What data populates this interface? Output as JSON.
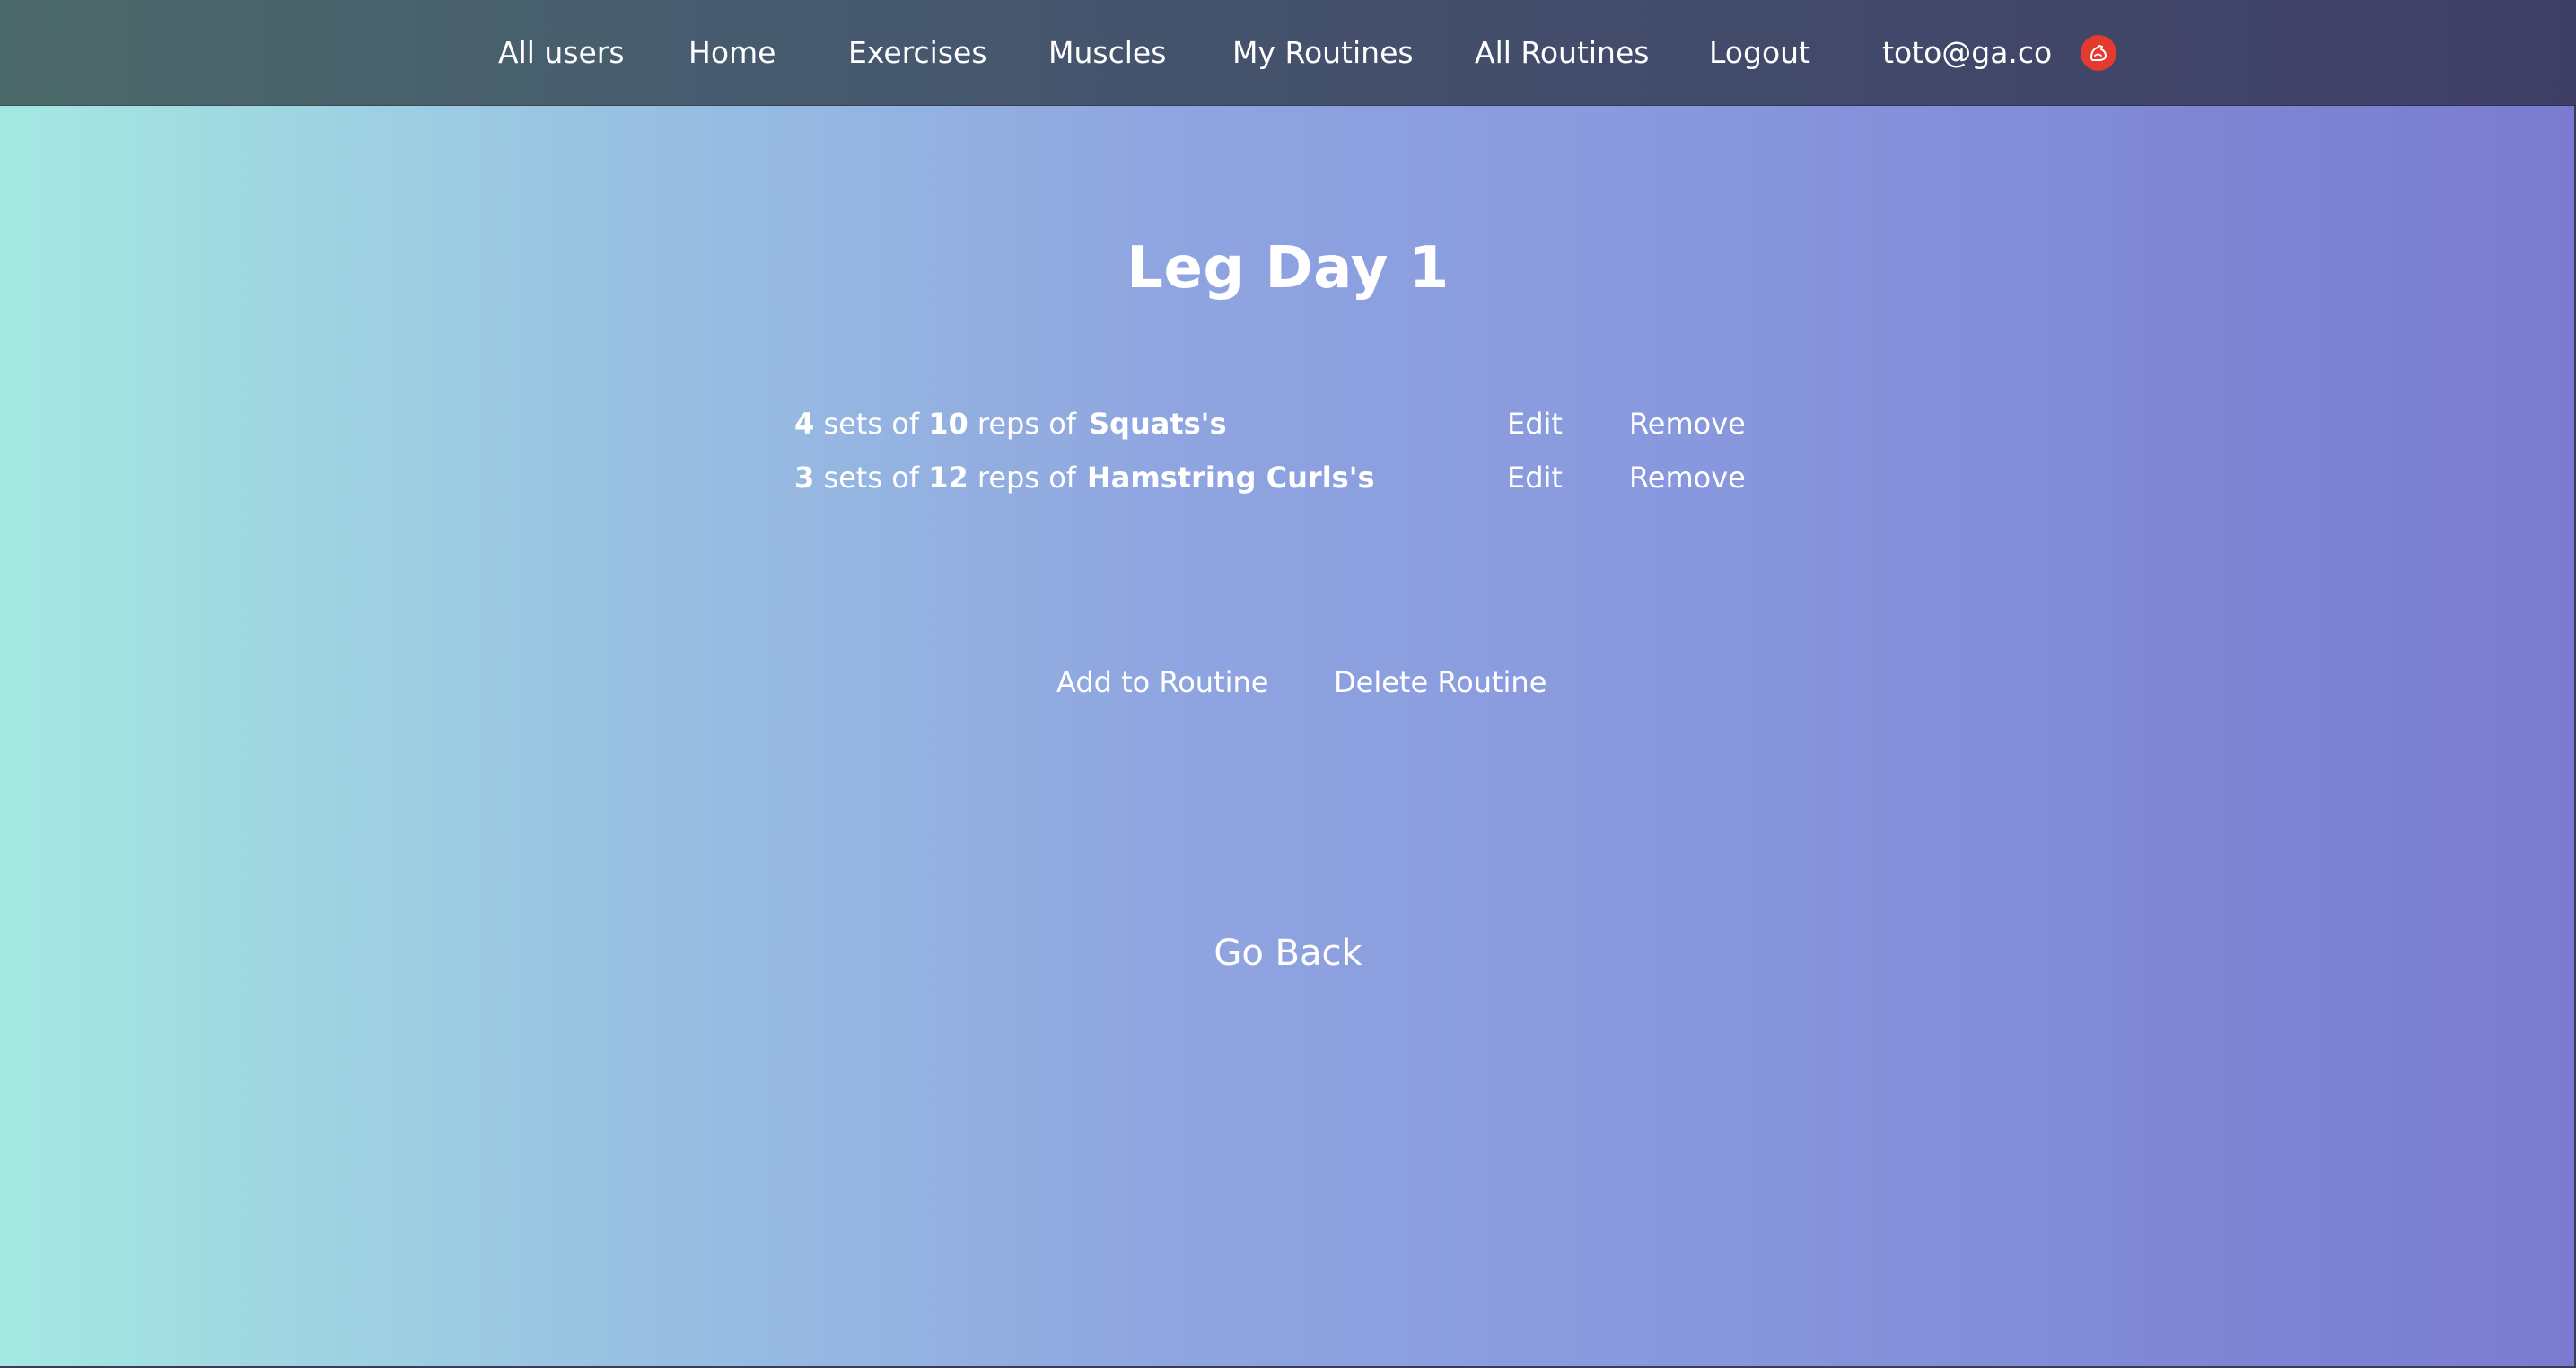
{
  "nav": {
    "items": [
      {
        "label": "All users"
      },
      {
        "label": "Home"
      },
      {
        "label": "Exercises"
      },
      {
        "label": "Muscles"
      },
      {
        "label": "My Routines"
      },
      {
        "label": "All Routines"
      },
      {
        "label": "Logout"
      }
    ],
    "user_email": "toto@ga.co",
    "avatar_icon": "muscle-icon",
    "avatar_color": "#e53a2f"
  },
  "routine": {
    "title": "Leg Day 1",
    "rows": [
      {
        "sets": "4",
        "sets_label": " sets of ",
        "reps": "10",
        "reps_label": " reps of",
        "exercise": "Squats's",
        "edit_label": "Edit",
        "remove_label": "Remove"
      },
      {
        "sets": "3",
        "sets_label": " sets of ",
        "reps": "12",
        "reps_label": " reps of",
        "exercise": "Hamstring Curls's",
        "edit_label": "Edit",
        "remove_label": "Remove"
      }
    ]
  },
  "actions": {
    "add_label": "Add to Routine",
    "delete_label": "Delete Routine",
    "go_back_label": "Go Back"
  },
  "colors": {
    "nav_start": "#4d6a6a",
    "nav_end": "#3f3f66",
    "bg_start": "#a5e8e1",
    "bg_end": "#7a7bd0"
  }
}
